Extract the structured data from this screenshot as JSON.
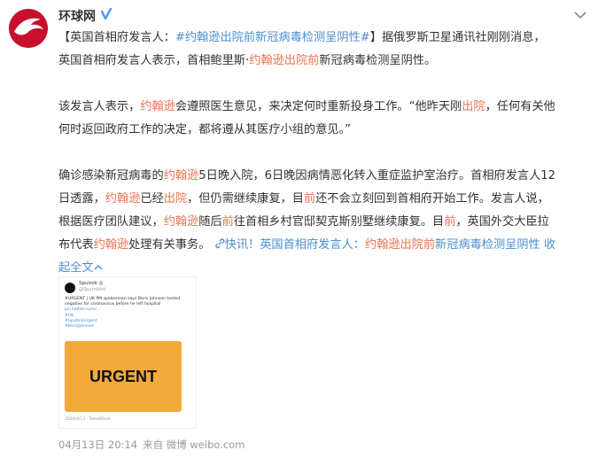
{
  "account": {
    "name": "环球网",
    "avatar_icon": "globe-wolf-logo-icon",
    "verified_icon": "verified-badge-icon"
  },
  "colors": {
    "link": "#eb7350",
    "topic": "#4b8fd0",
    "avatar_bg": "#c8102e",
    "urgent_card": "#f3a93b"
  },
  "post": {
    "p1": {
      "bracket_open": "【英国首相府发言人：",
      "tag": "#约翰逊出院前新冠病毒检测呈阴性#",
      "bracket_close": "】",
      "text1": "据俄罗斯卫星通讯社刚刚消息，",
      "text2": "英国首相府发言人表示，首相鲍里斯·",
      "link1": "约翰逊出院前",
      "text3": "新冠病毒检测呈阴性。"
    },
    "p2": {
      "text1": "该发言人表示，",
      "link1": "约翰逊",
      "text2": "会遵照医生意见，来决定何时重新投身工作。“他昨天刚",
      "link2": "出院",
      "text3": "，任何有关他",
      "text4": "何时返回政府工作的决定，都将遵从其医疗小组的意见。”"
    },
    "p3": {
      "text1": "确诊感染新冠病毒的",
      "link1": "约翰逊",
      "text2": "5日晚入院，6日晚因病情恶化转入重症监护室治疗。首相府发言人12",
      "text3": "日透露，",
      "link2": "约翰逊",
      "text4": "已经",
      "link3": "出院",
      "text5": "，但仍需继续康复，目",
      "link4": "前",
      "text6": "还不会立刻回到首相府开始工作。发言人说，",
      "text7": "根据医疗团队建议，",
      "link5": "约翰逊",
      "text8": "随后",
      "link6": "前",
      "text9": "往首相乡村官邸契克斯别墅继续康复。目",
      "link7": "前",
      "text10": "，英国外交大臣拉",
      "text11": "布代表",
      "link8": "约翰逊",
      "text12": "处理有关事务。",
      "share_text": "快讯！英国首相府发言人：",
      "share_link": "约翰逊出院前",
      "share_tail": "新冠病毒检测呈阴性",
      "collapse_1": "收",
      "collapse_2": "起全文"
    }
  },
  "media": {
    "tw_name": "Sputnik ◎",
    "tw_handle": "@SputnikInt",
    "tw_line1": "#URGENT | UK PM spokesman says Boris Johnson tested",
    "tw_line2": "negative for coronavirus before he left hospital",
    "tw_link": "pic.twitter.com/...",
    "tw_tag1": "#UK",
    "tw_tag2": "#SputnikUrgent",
    "tw_tag3": "#BorisJohnson",
    "card_text": "URGENT",
    "tw_time": "2020/4/13 · TweetDeck"
  },
  "footer": {
    "date": "04月13日 20:14",
    "source": "来自 微博 weibo.com"
  }
}
